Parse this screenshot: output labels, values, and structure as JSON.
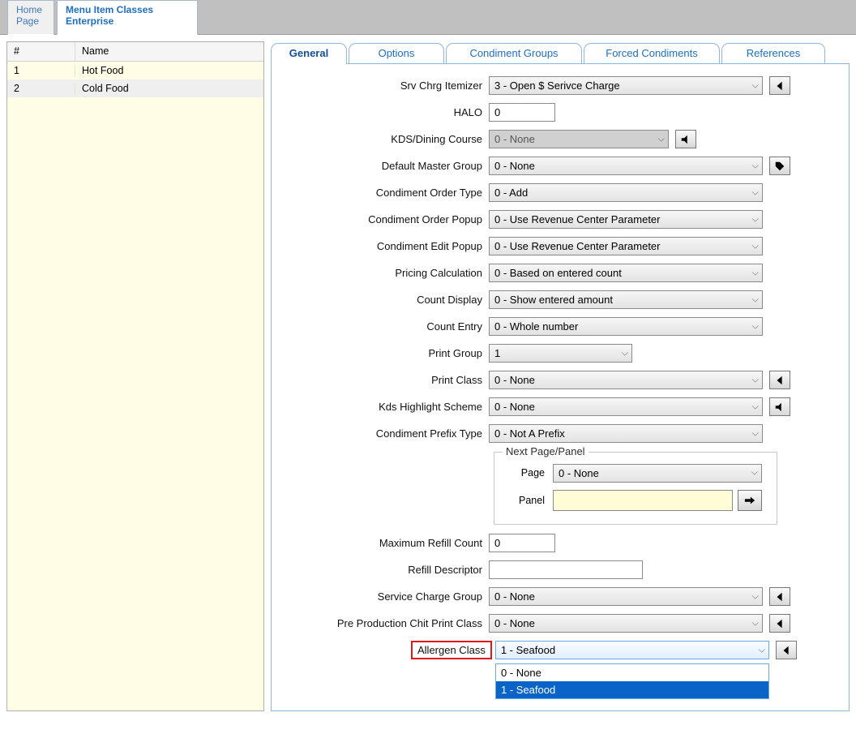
{
  "topTabs": {
    "home": {
      "line1": "Home",
      "line2": "Page"
    },
    "menu": {
      "line1": "Menu Item Classes",
      "line2": "Enterprise"
    }
  },
  "leftTable": {
    "headers": {
      "num": "#",
      "name": "Name"
    },
    "rows": [
      {
        "num": "1",
        "name": "Hot Food"
      },
      {
        "num": "2",
        "name": "Cold Food"
      }
    ]
  },
  "subTabs": {
    "general": "General",
    "options": "Options",
    "condimentGroups": "Condiment Groups",
    "forcedCondiments": "Forced Condiments",
    "references": "References"
  },
  "form": {
    "srvChrgItemizer": {
      "label": "Srv Chrg Itemizer",
      "value": "3 - Open $ Serivce Charge"
    },
    "halo": {
      "label": "HALO",
      "value": "0"
    },
    "kdsDiningCourse": {
      "label": "KDS/Dining Course",
      "value": "0 - None"
    },
    "defaultMasterGroup": {
      "label": "Default Master Group",
      "value": "0 - None"
    },
    "condimentOrderType": {
      "label": "Condiment Order Type",
      "value": "0 - Add"
    },
    "condimentOrderPopup": {
      "label": "Condiment Order Popup",
      "value": "0 - Use Revenue Center Parameter"
    },
    "condimentEditPopup": {
      "label": "Condiment Edit Popup",
      "value": "0 - Use Revenue Center Parameter"
    },
    "pricingCalculation": {
      "label": "Pricing Calculation",
      "value": "0 - Based on entered count"
    },
    "countDisplay": {
      "label": "Count Display",
      "value": "0 - Show entered amount"
    },
    "countEntry": {
      "label": "Count Entry",
      "value": "0 - Whole number"
    },
    "printGroup": {
      "label": "Print Group",
      "value": "1"
    },
    "printClass": {
      "label": "Print Class",
      "value": "0 - None"
    },
    "kdsHighlightScheme": {
      "label": "Kds Highlight Scheme",
      "value": "0 - None"
    },
    "condimentPrefixType": {
      "label": "Condiment Prefix Type",
      "value": "0 - Not A Prefix"
    },
    "nextPagePanel": {
      "legend": "Next Page/Panel",
      "pageLabel": "Page",
      "pageValue": "0 - None",
      "panelLabel": "Panel",
      "panelValue": ""
    },
    "maximumRefillCount": {
      "label": "Maximum Refill Count",
      "value": "0"
    },
    "refillDescriptor": {
      "label": "Refill Descriptor",
      "value": ""
    },
    "serviceChargeGroup": {
      "label": "Service Charge Group",
      "value": "0 - None"
    },
    "preProductionChit": {
      "label": "Pre Production Chit Print Class",
      "value": "0 - None"
    },
    "allergenClass": {
      "label": "Allergen Class",
      "value": "1 - Seafood",
      "options": [
        "0 - None",
        "1 - Seafood"
      ],
      "selectedIndex": 1
    }
  }
}
